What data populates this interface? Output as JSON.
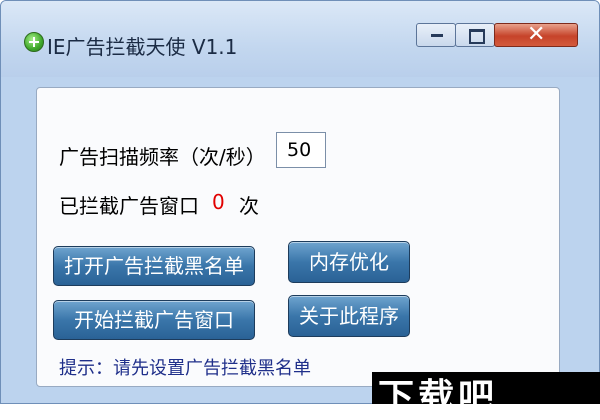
{
  "window": {
    "title": "IE广告拦截天使 V1.1",
    "controls": {
      "minimize": "minimize",
      "maximize": "maximize",
      "close": "✕"
    }
  },
  "scan": {
    "label": "广告扫描频率（次/秒）",
    "value": "50"
  },
  "blocked": {
    "label": "已拦截广告窗口",
    "count": "0",
    "unit": "次"
  },
  "buttons": {
    "blacklist": "打开广告拦截黑名单",
    "memory": "内存优化",
    "start": "开始拦截广告窗口",
    "about": "关于此程序"
  },
  "hint": "提示：请先设置广告拦截黑名单",
  "watermark": "下载吧",
  "colors": {
    "count": "#e10000",
    "hint": "#1f2f8a",
    "button": "#3a76aa"
  }
}
